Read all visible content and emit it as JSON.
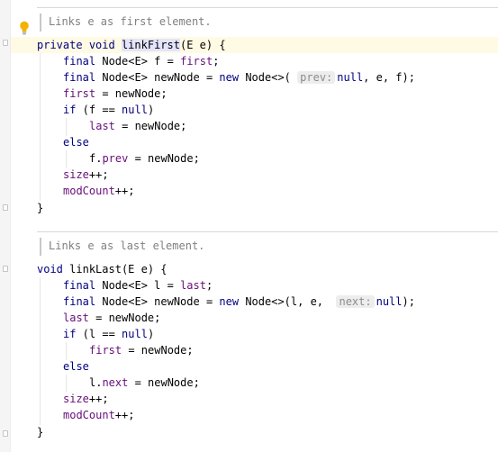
{
  "intention_icon": "lightbulb-icon",
  "method1": {
    "doc": "Links e as first element.",
    "signature": {
      "mod1": "private",
      "mod2": "void",
      "name": "linkFirst",
      "params": "(E e) {"
    },
    "l1": {
      "kw": "final",
      "type": "Node<E> f = ",
      "val": "first",
      "end": ";"
    },
    "l2": {
      "kw": "final",
      "type": "Node<E> newNode = ",
      "new": "new",
      "ctor": "Node<>(",
      "hint": "prev:",
      "nul": "null",
      "rest": ", e, f);"
    },
    "l3": {
      "fld": "first",
      "rest": " = newNode;"
    },
    "l4": {
      "kw": "if",
      "mid": " (f == ",
      "nul": "null",
      "end": ")"
    },
    "l5": {
      "fld": "last",
      "rest": " = newNode;"
    },
    "l6": {
      "kw": "else"
    },
    "l7": {
      "pre": "f.",
      "fld": "prev",
      "rest": " = newNode;"
    },
    "l8": {
      "fld": "size",
      "rest": "++;"
    },
    "l9": {
      "fld": "modCount",
      "rest": "++;"
    },
    "close": "}"
  },
  "method2": {
    "doc": "Links e as last element.",
    "signature": {
      "mod1": "void",
      "name": "linkLast",
      "params": "(E e) {"
    },
    "l1": {
      "kw": "final",
      "type": "Node<E> l = ",
      "val": "last",
      "end": ";"
    },
    "l2": {
      "kw": "final",
      "type": "Node<E> newNode = ",
      "new": "new",
      "ctor": "Node<>(l, e, ",
      "hint": "next:",
      "nul": "null",
      "rest": ");"
    },
    "l3": {
      "fld": "last",
      "rest": " = newNode;"
    },
    "l4": {
      "kw": "if",
      "mid": " (l == ",
      "nul": "null",
      "end": ")"
    },
    "l5": {
      "fld": "first",
      "rest": " = newNode;"
    },
    "l6": {
      "kw": "else"
    },
    "l7": {
      "pre": "l.",
      "fld": "next",
      "rest": " = newNode;"
    },
    "l8": {
      "fld": "size",
      "rest": "++;"
    },
    "l9": {
      "fld": "modCount",
      "rest": "++;"
    },
    "close": "}"
  },
  "colors": {
    "keyword": "#000080",
    "field": "#660e7a",
    "comment": "#808080",
    "caret_row": "#fffae3",
    "identifier_highlight": "#e4e4ff",
    "hint_bg": "#ededed"
  }
}
